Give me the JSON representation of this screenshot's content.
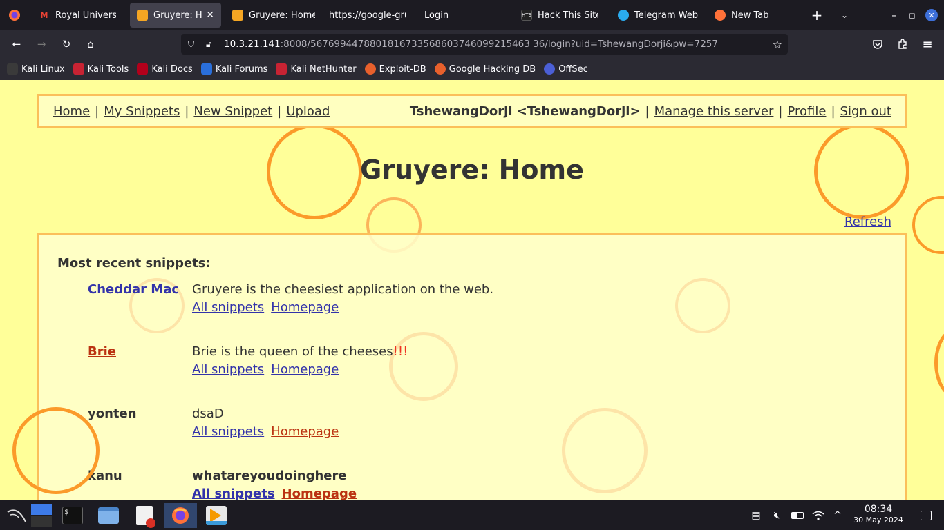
{
  "browser": {
    "tabs": [
      {
        "label": "Royal University",
        "favicon": "gmail-icon",
        "active": false
      },
      {
        "label": "Gruyere: Hon",
        "favicon": "gruyere-icon",
        "active": true
      },
      {
        "label": "Gruyere: Home",
        "favicon": "gruyere-icon",
        "active": false
      },
      {
        "label": "https://google-gru",
        "favicon": "",
        "active": false
      },
      {
        "label": "Login",
        "favicon": "",
        "active": false
      },
      {
        "label": "Hack This Site",
        "favicon": "hts-icon",
        "active": false
      },
      {
        "label": "Telegram Web",
        "favicon": "telegram-icon",
        "active": false
      },
      {
        "label": "New Tab",
        "favicon": "firefox-icon",
        "active": false
      }
    ],
    "url_host": "10.3.21.141",
    "url_rest": ":8008/5676994478801816733568603746099215463 36/login?uid=TshewangDorji&pw=7257",
    "bookmarks": [
      "Kali Linux",
      "Kali Tools",
      "Kali Docs",
      "Kali Forums",
      "Kali NetHunter",
      "Exploit-DB",
      "Google Hacking DB",
      "OffSec"
    ]
  },
  "page": {
    "menu": {
      "home": "Home",
      "my_snippets": "My Snippets",
      "new_snippet": "New Snippet",
      "upload": "Upload",
      "user": "TshewangDorji <TshewangDorji>",
      "manage": "Manage this server",
      "profile": "Profile",
      "signout": "Sign out",
      "separator": "|"
    },
    "title": "Gruyere: Home",
    "refresh": "Refresh",
    "recent_title": "Most recent snippets:",
    "snippets": [
      {
        "author": "Cheddar Mac",
        "text": "Gruyere is the cheesiest application on the web.",
        "all": "All snippets",
        "home": "Homepage"
      },
      {
        "author": "Brie",
        "text": "Brie is the queen of the cheeses",
        "text_suffix": "!!!",
        "all": "All snippets",
        "home": "Homepage"
      },
      {
        "author": "yonten",
        "text": "dsaD",
        "all": "All snippets",
        "home": "Homepage"
      },
      {
        "author": "kanu",
        "text": "whatareyoudoinghere",
        "all": "All snippets",
        "home": "Homepage"
      }
    ]
  },
  "taskbar": {
    "time": "08:34",
    "date": "30 May 2024"
  },
  "colors": {
    "page_bg": "#ffff99",
    "ring": "#fb9a2a",
    "link_blue": "#3333aa",
    "link_red": "#bb3311"
  }
}
